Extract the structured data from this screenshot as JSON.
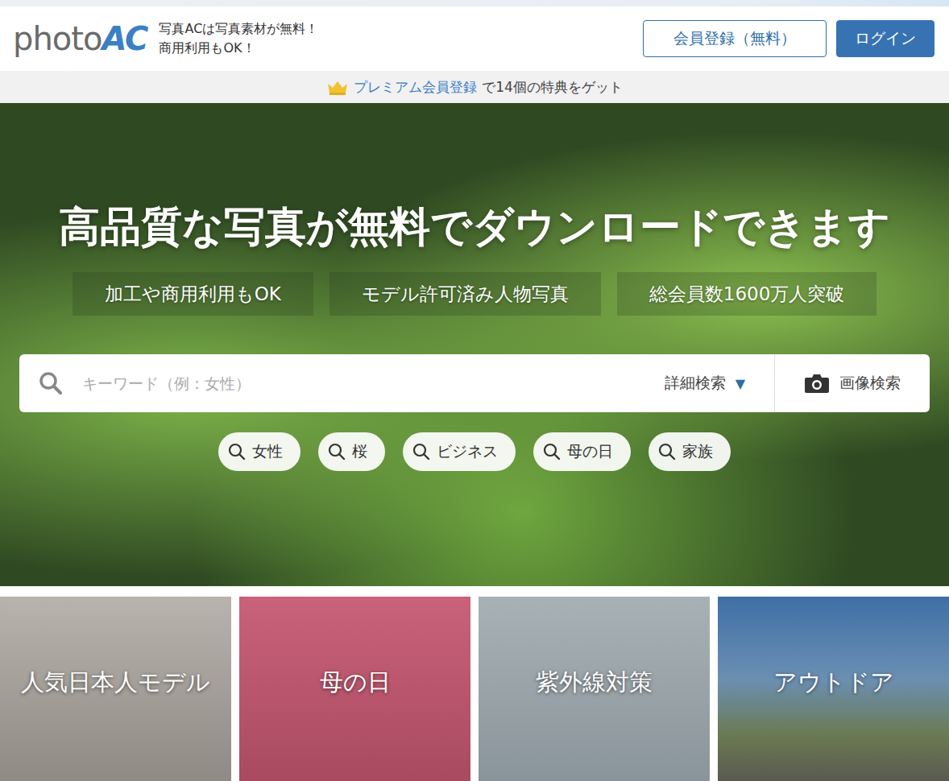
{
  "header": {
    "logo": {
      "prefix": "photo",
      "suffix": "AC"
    },
    "tagline": [
      "写真ACは写真素材が無料！",
      "商用利用もOK！"
    ],
    "buttons": [
      {
        "label": "会員登録（無料）",
        "kind": "outline"
      },
      {
        "label": "ログイン",
        "kind": "filled"
      }
    ]
  },
  "premium_banner": {
    "link": "プレミアム会員登録",
    "text": "で14個の特典をゲット"
  },
  "hero": {
    "title": "高品質な写真が無料でダウンロードできます",
    "features": [
      "加工や商用利用もOK",
      "モデル許可済み人物写真",
      "総会員数1600万人突破"
    ],
    "search": {
      "placeholder": "キーワード（例：女性）",
      "advanced": "詳細検索",
      "advanced_arrow": "▼",
      "image_search": "画像検索"
    },
    "tags": [
      "女性",
      "桜",
      "ビジネス",
      "母の日",
      "家族"
    ]
  },
  "categories": [
    {
      "label": "人気日本人モデル"
    },
    {
      "label": "母の日"
    },
    {
      "label": "紫外線対策"
    },
    {
      "label": "アウトドア"
    }
  ]
}
